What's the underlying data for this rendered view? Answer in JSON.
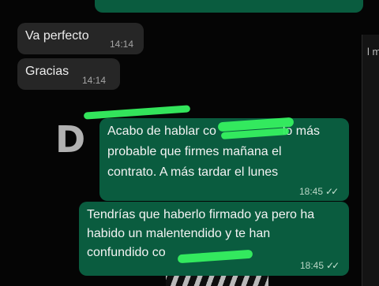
{
  "messages": [
    {
      "type": "incoming",
      "text": "Va perfecto",
      "time": "14:14"
    },
    {
      "type": "incoming",
      "text": "Gracias",
      "time": "14:14"
    },
    {
      "type": "outgoing",
      "lines": [
        "Acabo de hablar co",
        "lo más",
        "probable que firmes mañana el",
        "contrato. A más tardar el lunes"
      ],
      "time": "18:45",
      "ticks": "✓✓"
    },
    {
      "type": "outgoing",
      "lines": [
        "Tendrías que haberlo firmado ya pero ha",
        "habido un malentendido y te han",
        "confundido co"
      ],
      "time": "18:45",
      "ticks": "✓✓"
    }
  ],
  "wallpaper": {
    "sticker_text": "D",
    "side_text": "l m"
  },
  "colors": {
    "outgoing_bubble": "#0a5c3f",
    "incoming_bubble": "#262626",
    "redaction": "#36f060"
  }
}
